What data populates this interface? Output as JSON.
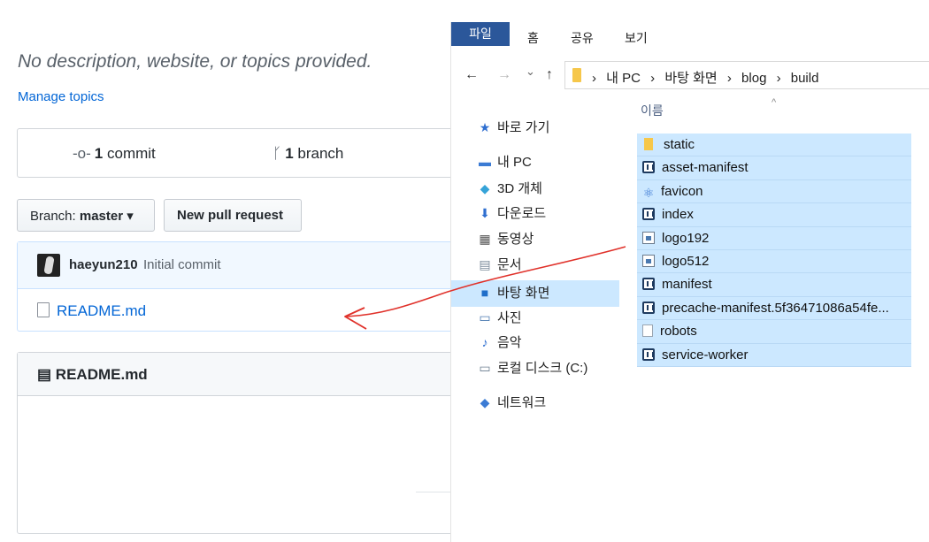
{
  "github": {
    "description": "No description, website, or topics provided.",
    "manage_topics": "Manage topics",
    "stats": {
      "commits_count": "1",
      "commits_label": "commit",
      "branches_count": "1",
      "branches_label": "branch"
    },
    "branch_button": {
      "prefix": "Branch:",
      "value": "master",
      "caret": "▾"
    },
    "new_pull_request": "New pull request",
    "latest_commit": {
      "user": "haeyun210",
      "message": "Initial commit"
    },
    "files": [
      "README.md"
    ],
    "readme_title": "README.md"
  },
  "explorer": {
    "ribbon_tabs": [
      "파일",
      "홈",
      "공유",
      "보기"
    ],
    "nav_buttons": {
      "back": "←",
      "forward": "→",
      "recent": "⌄",
      "up": "↑"
    },
    "breadcrumb": [
      "내 PC",
      "바탕 화면",
      "blog",
      "build"
    ],
    "breadcrumb_sep": "›",
    "nav_pane": [
      {
        "label": "바로 가기",
        "icon": "star-icon"
      },
      {
        "label": "내 PC",
        "icon": "computer-icon"
      },
      {
        "label": "3D 개체",
        "icon": "cube-icon"
      },
      {
        "label": "다운로드",
        "icon": "download-icon"
      },
      {
        "label": "동영상",
        "icon": "video-icon"
      },
      {
        "label": "문서",
        "icon": "document-icon"
      },
      {
        "label": "바탕 화면",
        "icon": "desktop-icon",
        "selected": true
      },
      {
        "label": "사진",
        "icon": "pictures-icon"
      },
      {
        "label": "음악",
        "icon": "music-icon"
      },
      {
        "label": "로컬 디스크 (C:)",
        "icon": "drive-icon"
      },
      {
        "label": "네트워크",
        "icon": "network-icon"
      }
    ],
    "column_header": "이름",
    "sort_indicator": "^",
    "file_list": [
      {
        "name": "static",
        "type": "folder"
      },
      {
        "name": "asset-manifest",
        "type": "json"
      },
      {
        "name": "favicon",
        "type": "react"
      },
      {
        "name": "index",
        "type": "json"
      },
      {
        "name": "logo192",
        "type": "img"
      },
      {
        "name": "logo512",
        "type": "img"
      },
      {
        "name": "manifest",
        "type": "json"
      },
      {
        "name": "precache-manifest.5f36471086a54fe...",
        "type": "json"
      },
      {
        "name": "robots",
        "type": "txt"
      },
      {
        "name": "service-worker",
        "type": "json"
      }
    ]
  },
  "colors": {
    "link": "#0366d6",
    "selection": "#cce8ff",
    "ribbon_file_tab": "#2b579a",
    "annotation_arrow": "#e0312a"
  }
}
